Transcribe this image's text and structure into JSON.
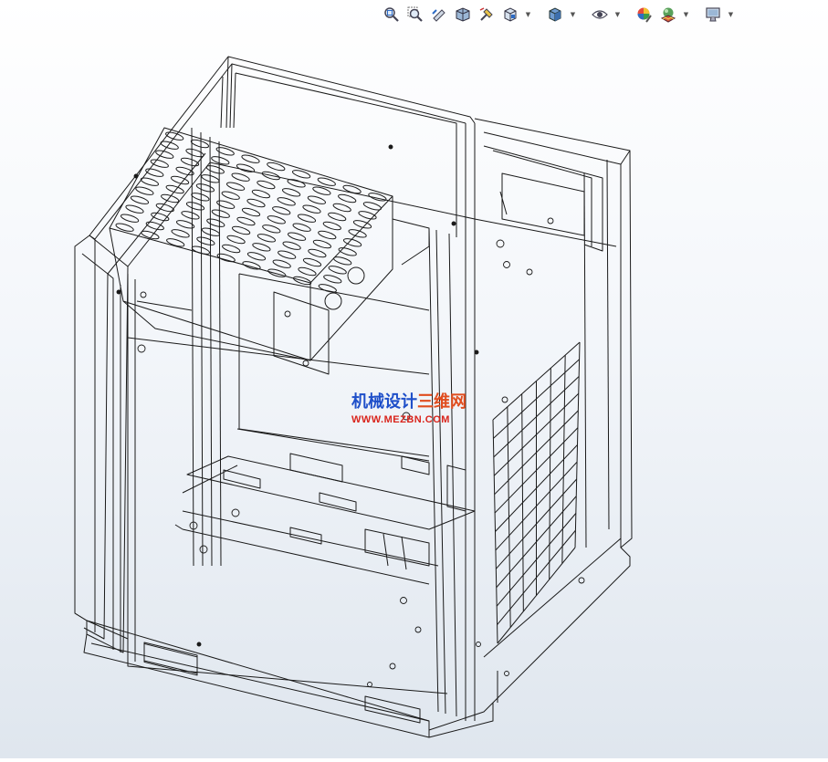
{
  "toolbar": {
    "buttons": [
      {
        "name": "zoom-to-fit-icon"
      },
      {
        "name": "zoom-to-area-icon"
      },
      {
        "name": "previous-view-icon"
      },
      {
        "name": "section-view-icon"
      },
      {
        "name": "view-dynamic-annotation-icon"
      },
      {
        "name": "view-orientation-icon",
        "dropdown": true
      },
      {
        "name": "display-style-icon",
        "dropdown": true
      },
      {
        "name": "hide-show-items-icon",
        "dropdown": true
      },
      {
        "name": "edit-appearance-icon"
      },
      {
        "name": "apply-scene-icon",
        "dropdown": true
      },
      {
        "name": "view-settings-icon",
        "dropdown": true
      }
    ],
    "dropdown_glyph": "▼"
  },
  "watermark": {
    "text_main": "机械设计",
    "text_highlight": "三维网",
    "url": "WWW.MEZBN.COM"
  },
  "colors": {
    "wire": "#1a1a1a",
    "background_top": "#ffffff",
    "background_bottom": "#dfe6ee",
    "watermark_blue": "#1e4fc9",
    "watermark_red": "#d9241c"
  }
}
